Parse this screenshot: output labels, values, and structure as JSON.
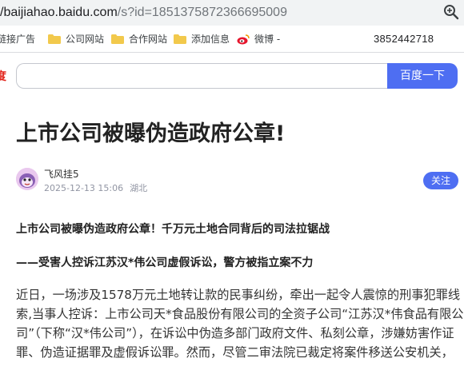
{
  "browser": {
    "url_host": "/baijiahao.baidu.com",
    "url_query": "/s?id=1851375872366695009",
    "bookmarks": [
      {
        "label": "链接广告",
        "icon": "none"
      },
      {
        "label": "公司网站",
        "icon": "folder-icon"
      },
      {
        "label": "合作网站",
        "icon": "folder-icon"
      },
      {
        "label": "添加信息",
        "icon": "folder-icon"
      },
      {
        "label": "微博 -",
        "icon": "weibo-icon"
      }
    ],
    "bookmark_number": "3852442718"
  },
  "search": {
    "placeholder": "",
    "button_label": "百度一下",
    "left_glyph": "度"
  },
  "article": {
    "title": "上市公司被曝伪造政府公章!",
    "author": "飞风挂5",
    "date": "2025-12-13 15:06",
    "location": "湖北",
    "follow_label": "关注",
    "subtitle1": "上市公司被曝伪造政府公章！千万元土地合同背后的司法拉锯战",
    "subtitle2": "——受害人控诉江苏汉*伟公司虚假诉讼，警方被指立案不力",
    "body_lines": [
      "近日，一场涉及1578万元土地转让款的民事纠纷，牵出一起令人震惊的刑事犯罪线",
      "索,当事人控诉：上市公司天*食品股份有限公司的全资子公司“江苏汉*伟食品有限公",
      "司”（下称“汉*伟公司”），在诉讼中伪造多部门政府文件、私刻公章，涉嫌妨害作证",
      "罪、伪造证据罪及虚假诉讼罪。然而，尽管二审法院已裁定将案件移送公安机关，"
    ]
  },
  "colors": {
    "accent": "#4e6ef2",
    "folder": "#f2c94c",
    "weibo": "#e6162d"
  }
}
